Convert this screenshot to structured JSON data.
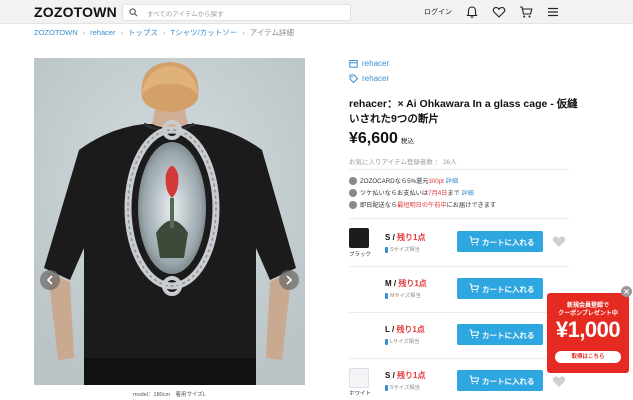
{
  "header": {
    "logo": "ZOZOTOWN",
    "search_placeholder": "すべてのアイテムから探す",
    "login": "ログイン"
  },
  "breadcrumb": [
    "ZOZOTOWN",
    "rehacer",
    "トップス",
    "Tシャツ/カットソー",
    "アイテム詳細"
  ],
  "product": {
    "brand": "rehacer",
    "shop": "rehacer",
    "title": "rehacer：× Ai Ohkawara In a glass cage - 仮縫いされた9つの断片",
    "price": "¥6,600",
    "tax_label": "税込",
    "fav_count_text": "お気に入りアイテム登録者数 ： 26人",
    "model_caption": "model：180cm　着用サイズL"
  },
  "perks": [
    {
      "pre": "ZOZOCARDなら5%還元",
      "hl": "300pt",
      "post": "",
      "link": "詳細"
    },
    {
      "pre": "ツケ払いならお支払いは",
      "hl": "7月4日",
      "post": "まで",
      "link": "詳細"
    },
    {
      "pre": "即日配送なら",
      "hl": "最短明日の午前中",
      "post": "にお届けできます",
      "link": ""
    }
  ],
  "variants": [
    {
      "color": "ブラック",
      "size": "S",
      "stock": "残り1点",
      "note": "Sサイズ相当",
      "cart": "カートに入れる"
    },
    {
      "color": "",
      "size": "M",
      "stock": "残り1点",
      "note": "Mサイズ相当",
      "cart": "カートに入れる"
    },
    {
      "color": "",
      "size": "L",
      "stock": "残り1点",
      "note": "Lサイズ相当",
      "cart": "カートに入れる"
    },
    {
      "color": "ホワイト",
      "size": "S",
      "stock": "残り1点",
      "note": "Sサイズ相当",
      "cart": "カートに入れる"
    }
  ],
  "coupon": {
    "line1": "新規会員登録で",
    "line2": "クーポンプレゼント中",
    "amount": "¥1,000",
    "button": "取得はこちら"
  },
  "colors": {
    "link": "#3a8fd0",
    "cart": "#2ea7e0",
    "alert": "#e3393c",
    "coupon": "#e52a21"
  }
}
